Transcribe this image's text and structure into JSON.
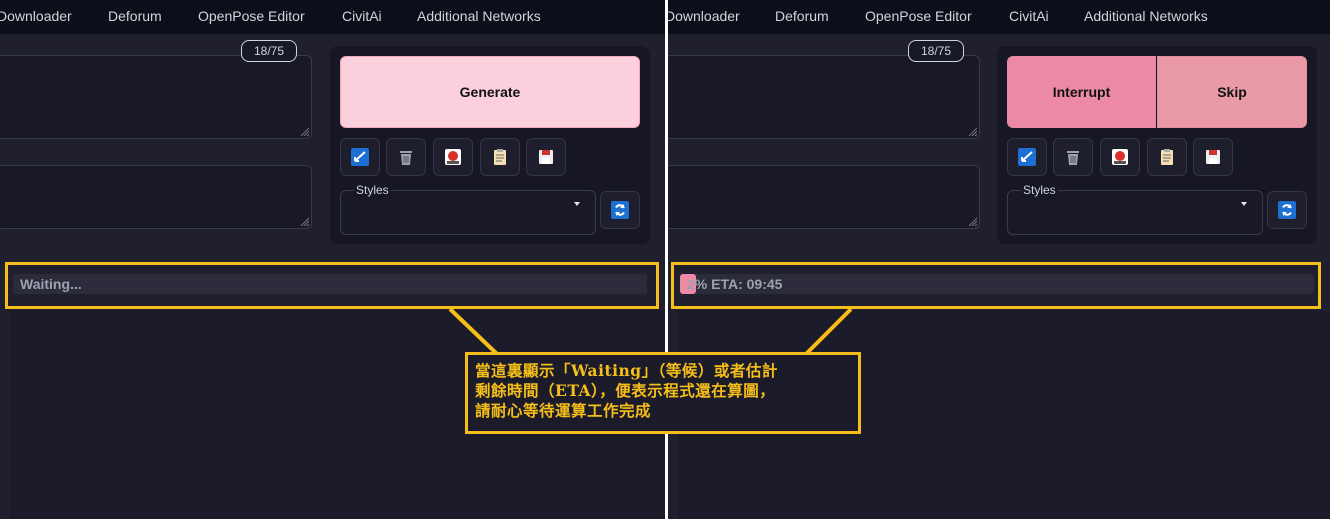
{
  "tabs": [
    "Downloader",
    "Deforum",
    "OpenPose Editor",
    "CivitAi",
    "Additional Networks"
  ],
  "left": {
    "token_counter": "18/75",
    "generate_label": "Generate",
    "styles_label": "Styles",
    "progress_text": "Waiting..."
  },
  "right": {
    "token_counter": "18/75",
    "interrupt_label": "Interrupt",
    "skip_label": "Skip",
    "styles_label": "Styles",
    "progress_text": "2% ETA: 09:45",
    "progress_fraction": 0.02
  },
  "toolbar_icons": [
    "arrow-check-icon",
    "trash-icon",
    "image-icon",
    "clipboard-icon",
    "save-icon"
  ],
  "callout": {
    "line1": "當這裏顯示「Waiting」（等候）或者估計",
    "line2": "剩餘時間（ETA），便表示程式還在算圖，",
    "line3": "請耐心等待運算工作完成"
  },
  "colors": {
    "highlight": "#f6be1a",
    "generate": "#fbd0dc",
    "interrupt": "#ec8aa6",
    "skip": "#e99aa6",
    "background": "#0b0f19"
  }
}
